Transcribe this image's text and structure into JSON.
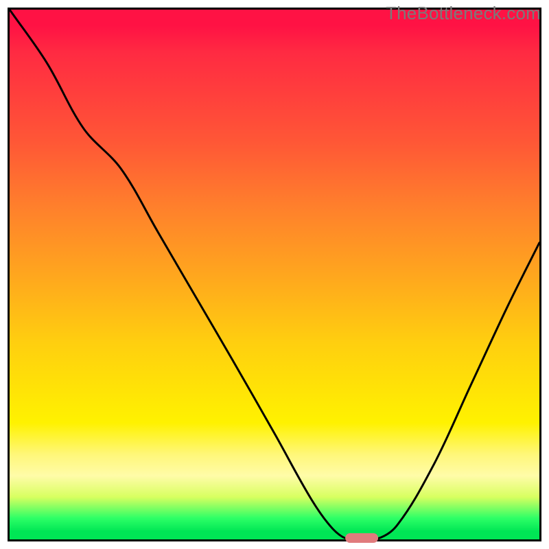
{
  "watermark": "TheBottleneck.com",
  "chart_data": {
    "type": "line",
    "title": "",
    "xlabel": "",
    "ylabel": "",
    "xlim": [
      0,
      1
    ],
    "ylim": [
      0,
      1
    ],
    "grid": false,
    "legend": false,
    "axes_visible": false,
    "background": {
      "type": "vertical_gradient",
      "stops": [
        {
          "pos": 0.0,
          "color": "#ff1244"
        },
        {
          "pos": 0.25,
          "color": "#ff5736"
        },
        {
          "pos": 0.5,
          "color": "#ffa61e"
        },
        {
          "pos": 0.78,
          "color": "#fff200"
        },
        {
          "pos": 0.92,
          "color": "#d8ff60"
        },
        {
          "pos": 1.0,
          "color": "#00e655"
        }
      ]
    },
    "series": [
      {
        "name": "bottleneck-curve",
        "color": "#000000",
        "stroke_width": 3,
        "x": [
          0.0,
          0.07,
          0.14,
          0.21,
          0.28,
          0.35,
          0.42,
          0.5,
          0.57,
          0.61,
          0.64,
          0.69,
          0.73,
          0.8,
          0.87,
          0.94,
          1.0
        ],
        "y": [
          1.0,
          0.9,
          0.775,
          0.7,
          0.58,
          0.46,
          0.34,
          0.2,
          0.075,
          0.02,
          0.0,
          0.0,
          0.025,
          0.14,
          0.29,
          0.44,
          0.56
        ]
      }
    ],
    "marker": {
      "name": "sweet-spot",
      "shape": "pill",
      "color": "#e07b7d",
      "x": 0.665,
      "y": 0.003,
      "width_frac": 0.062,
      "height_frac": 0.018
    }
  }
}
